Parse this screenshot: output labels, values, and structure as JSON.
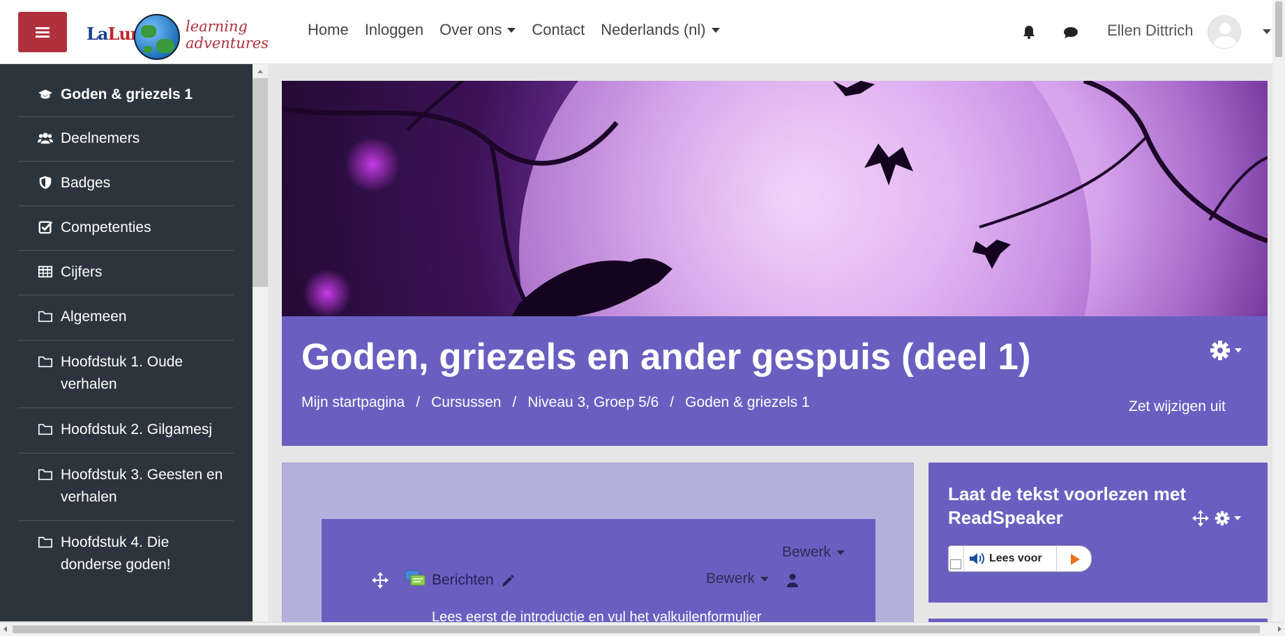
{
  "brand": {
    "logo_text_la": "La",
    "logo_text_luna": "Luna",
    "logo_tagline_1": "learning",
    "logo_tagline_2": "adventures"
  },
  "navbar": {
    "menu_icon": "hamburger-icon",
    "links": [
      {
        "label": "Home"
      },
      {
        "label": "Inloggen"
      },
      {
        "label": "Over ons"
      },
      {
        "label": "Contact"
      },
      {
        "label": "Nederlands (nl)"
      }
    ],
    "notification_icon": "bell-icon",
    "messages_icon": "chat-icon",
    "user_name": "Ellen Dittrich"
  },
  "drawer": {
    "items": [
      {
        "label": "Goden & griezels 1",
        "icon": "graduation-cap-icon"
      },
      {
        "label": "Deelnemers",
        "icon": "users-icon"
      },
      {
        "label": "Badges",
        "icon": "shield-icon"
      },
      {
        "label": "Competenties",
        "icon": "check-square-icon"
      },
      {
        "label": "Cijfers",
        "icon": "table-icon"
      },
      {
        "label": "Algemeen",
        "icon": "folder-icon"
      },
      {
        "label": "Hoofdstuk 1. Oude verhalen",
        "icon": "folder-icon"
      },
      {
        "label": "Hoofdstuk 2. Gilgamesj",
        "icon": "folder-icon"
      },
      {
        "label": "Hoofdstuk 3. Geesten en verhalen",
        "icon": "folder-icon"
      },
      {
        "label": "Hoofdstuk 4. Die donderse goden!",
        "icon": "folder-icon"
      }
    ]
  },
  "course": {
    "title": "Goden, griezels en ander gespuis (deel 1)",
    "breadcrumb": [
      "Mijn startpagina",
      "Cursussen",
      "Niveau 3, Groep 5/6",
      "Goden & griezels 1"
    ],
    "breadcrumb_separator": "/",
    "edit_toggle": "Zet wijzigen uit"
  },
  "berichten_block": {
    "edit_menu_top": "Bewerk",
    "edit_menu_activity": "Bewerk",
    "activity_name": "Berichten",
    "intro": "Lees eerst de introductie en vul het valkuilenformulier"
  },
  "readspeaker_block": {
    "title": "Laat de tekst voorlezen met ReadSpeaker",
    "player_label": "Lees voor"
  },
  "colors": {
    "accent": "#6a5fc1",
    "brand_red": "#b0313c",
    "drawer_bg": "#2c353d",
    "play_orange": "#e8731b"
  }
}
